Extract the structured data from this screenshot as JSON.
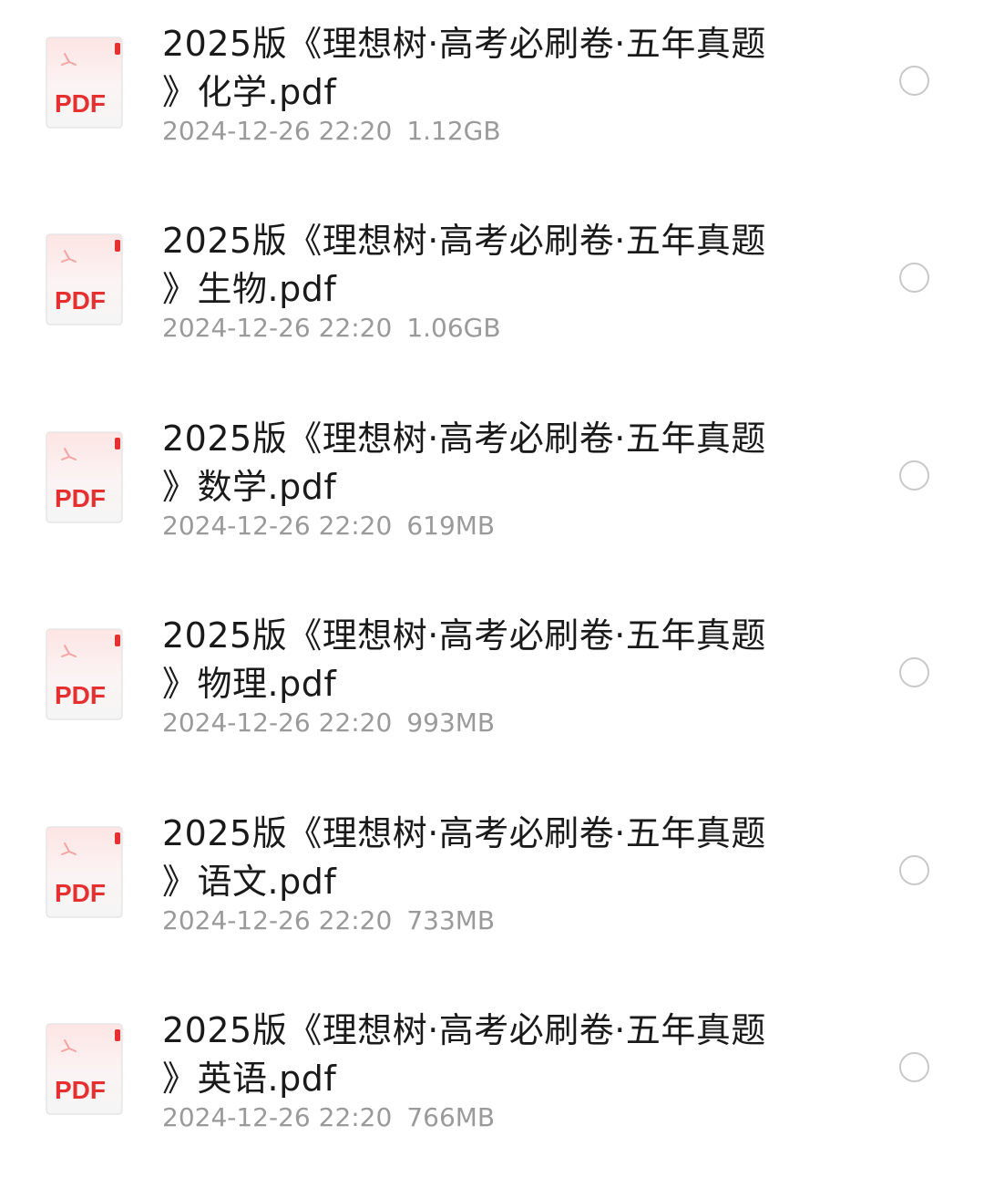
{
  "colors": {
    "pdf_red": "#e5302f",
    "title_text": "#1a1a1a",
    "meta_text": "#9a9a9a",
    "radio_border": "#c8c8c8"
  },
  "files": [
    {
      "icon": "pdf-file-icon",
      "icon_label": "PDF",
      "name_line1": "2025版《理想树·高考必刷卷·五年真题",
      "name_line2": "》化学.pdf",
      "date": "2024-12-26 22:20",
      "size": "1.12GB"
    },
    {
      "icon": "pdf-file-icon",
      "icon_label": "PDF",
      "name_line1": "2025版《理想树·高考必刷卷·五年真题",
      "name_line2": "》生物.pdf",
      "date": "2024-12-26 22:20",
      "size": "1.06GB"
    },
    {
      "icon": "pdf-file-icon",
      "icon_label": "PDF",
      "name_line1": "2025版《理想树·高考必刷卷·五年真题",
      "name_line2": "》数学.pdf",
      "date": "2024-12-26 22:20",
      "size": "619MB"
    },
    {
      "icon": "pdf-file-icon",
      "icon_label": "PDF",
      "name_line1": "2025版《理想树·高考必刷卷·五年真题",
      "name_line2": "》物理.pdf",
      "date": "2024-12-26 22:20",
      "size": "993MB"
    },
    {
      "icon": "pdf-file-icon",
      "icon_label": "PDF",
      "name_line1": "2025版《理想树·高考必刷卷·五年真题",
      "name_line2": "》语文.pdf",
      "date": "2024-12-26 22:20",
      "size": "733MB"
    },
    {
      "icon": "pdf-file-icon",
      "icon_label": "PDF",
      "name_line1": "2025版《理想树·高考必刷卷·五年真题",
      "name_line2": "》英语.pdf",
      "date": "2024-12-26 22:20",
      "size": "766MB"
    }
  ]
}
